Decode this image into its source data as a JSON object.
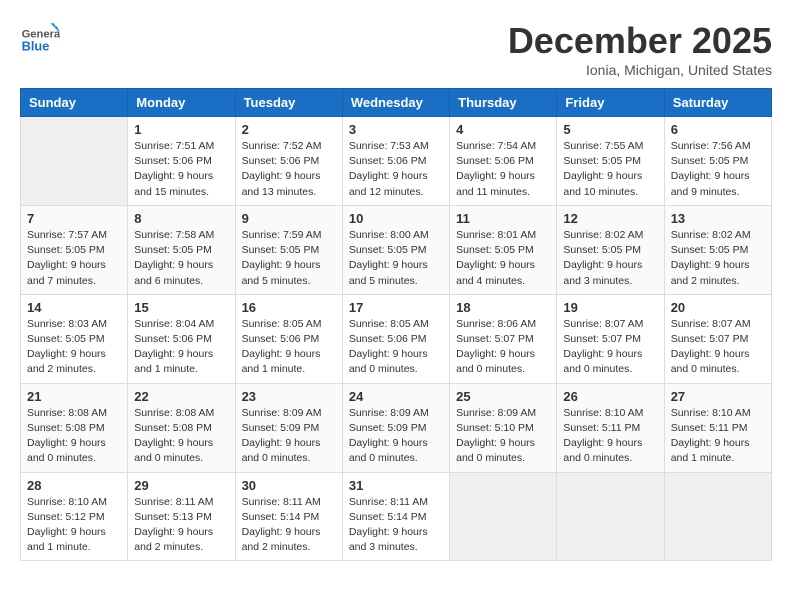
{
  "header": {
    "logo_general": "General",
    "logo_blue": "Blue",
    "month_title": "December 2025",
    "location": "Ionia, Michigan, United States"
  },
  "weekdays": [
    "Sunday",
    "Monday",
    "Tuesday",
    "Wednesday",
    "Thursday",
    "Friday",
    "Saturday"
  ],
  "weeks": [
    [
      {
        "num": "",
        "sunrise": "",
        "sunset": "",
        "daylight": ""
      },
      {
        "num": "1",
        "sunrise": "Sunrise: 7:51 AM",
        "sunset": "Sunset: 5:06 PM",
        "daylight": "Daylight: 9 hours and 15 minutes."
      },
      {
        "num": "2",
        "sunrise": "Sunrise: 7:52 AM",
        "sunset": "Sunset: 5:06 PM",
        "daylight": "Daylight: 9 hours and 13 minutes."
      },
      {
        "num": "3",
        "sunrise": "Sunrise: 7:53 AM",
        "sunset": "Sunset: 5:06 PM",
        "daylight": "Daylight: 9 hours and 12 minutes."
      },
      {
        "num": "4",
        "sunrise": "Sunrise: 7:54 AM",
        "sunset": "Sunset: 5:06 PM",
        "daylight": "Daylight: 9 hours and 11 minutes."
      },
      {
        "num": "5",
        "sunrise": "Sunrise: 7:55 AM",
        "sunset": "Sunset: 5:05 PM",
        "daylight": "Daylight: 9 hours and 10 minutes."
      },
      {
        "num": "6",
        "sunrise": "Sunrise: 7:56 AM",
        "sunset": "Sunset: 5:05 PM",
        "daylight": "Daylight: 9 hours and 9 minutes."
      }
    ],
    [
      {
        "num": "7",
        "sunrise": "Sunrise: 7:57 AM",
        "sunset": "Sunset: 5:05 PM",
        "daylight": "Daylight: 9 hours and 7 minutes."
      },
      {
        "num": "8",
        "sunrise": "Sunrise: 7:58 AM",
        "sunset": "Sunset: 5:05 PM",
        "daylight": "Daylight: 9 hours and 6 minutes."
      },
      {
        "num": "9",
        "sunrise": "Sunrise: 7:59 AM",
        "sunset": "Sunset: 5:05 PM",
        "daylight": "Daylight: 9 hours and 5 minutes."
      },
      {
        "num": "10",
        "sunrise": "Sunrise: 8:00 AM",
        "sunset": "Sunset: 5:05 PM",
        "daylight": "Daylight: 9 hours and 5 minutes."
      },
      {
        "num": "11",
        "sunrise": "Sunrise: 8:01 AM",
        "sunset": "Sunset: 5:05 PM",
        "daylight": "Daylight: 9 hours and 4 minutes."
      },
      {
        "num": "12",
        "sunrise": "Sunrise: 8:02 AM",
        "sunset": "Sunset: 5:05 PM",
        "daylight": "Daylight: 9 hours and 3 minutes."
      },
      {
        "num": "13",
        "sunrise": "Sunrise: 8:02 AM",
        "sunset": "Sunset: 5:05 PM",
        "daylight": "Daylight: 9 hours and 2 minutes."
      }
    ],
    [
      {
        "num": "14",
        "sunrise": "Sunrise: 8:03 AM",
        "sunset": "Sunset: 5:05 PM",
        "daylight": "Daylight: 9 hours and 2 minutes."
      },
      {
        "num": "15",
        "sunrise": "Sunrise: 8:04 AM",
        "sunset": "Sunset: 5:06 PM",
        "daylight": "Daylight: 9 hours and 1 minute."
      },
      {
        "num": "16",
        "sunrise": "Sunrise: 8:05 AM",
        "sunset": "Sunset: 5:06 PM",
        "daylight": "Daylight: 9 hours and 1 minute."
      },
      {
        "num": "17",
        "sunrise": "Sunrise: 8:05 AM",
        "sunset": "Sunset: 5:06 PM",
        "daylight": "Daylight: 9 hours and 0 minutes."
      },
      {
        "num": "18",
        "sunrise": "Sunrise: 8:06 AM",
        "sunset": "Sunset: 5:07 PM",
        "daylight": "Daylight: 9 hours and 0 minutes."
      },
      {
        "num": "19",
        "sunrise": "Sunrise: 8:07 AM",
        "sunset": "Sunset: 5:07 PM",
        "daylight": "Daylight: 9 hours and 0 minutes."
      },
      {
        "num": "20",
        "sunrise": "Sunrise: 8:07 AM",
        "sunset": "Sunset: 5:07 PM",
        "daylight": "Daylight: 9 hours and 0 minutes."
      }
    ],
    [
      {
        "num": "21",
        "sunrise": "Sunrise: 8:08 AM",
        "sunset": "Sunset: 5:08 PM",
        "daylight": "Daylight: 9 hours and 0 minutes."
      },
      {
        "num": "22",
        "sunrise": "Sunrise: 8:08 AM",
        "sunset": "Sunset: 5:08 PM",
        "daylight": "Daylight: 9 hours and 0 minutes."
      },
      {
        "num": "23",
        "sunrise": "Sunrise: 8:09 AM",
        "sunset": "Sunset: 5:09 PM",
        "daylight": "Daylight: 9 hours and 0 minutes."
      },
      {
        "num": "24",
        "sunrise": "Sunrise: 8:09 AM",
        "sunset": "Sunset: 5:09 PM",
        "daylight": "Daylight: 9 hours and 0 minutes."
      },
      {
        "num": "25",
        "sunrise": "Sunrise: 8:09 AM",
        "sunset": "Sunset: 5:10 PM",
        "daylight": "Daylight: 9 hours and 0 minutes."
      },
      {
        "num": "26",
        "sunrise": "Sunrise: 8:10 AM",
        "sunset": "Sunset: 5:11 PM",
        "daylight": "Daylight: 9 hours and 0 minutes."
      },
      {
        "num": "27",
        "sunrise": "Sunrise: 8:10 AM",
        "sunset": "Sunset: 5:11 PM",
        "daylight": "Daylight: 9 hours and 1 minute."
      }
    ],
    [
      {
        "num": "28",
        "sunrise": "Sunrise: 8:10 AM",
        "sunset": "Sunset: 5:12 PM",
        "daylight": "Daylight: 9 hours and 1 minute."
      },
      {
        "num": "29",
        "sunrise": "Sunrise: 8:11 AM",
        "sunset": "Sunset: 5:13 PM",
        "daylight": "Daylight: 9 hours and 2 minutes."
      },
      {
        "num": "30",
        "sunrise": "Sunrise: 8:11 AM",
        "sunset": "Sunset: 5:14 PM",
        "daylight": "Daylight: 9 hours and 2 minutes."
      },
      {
        "num": "31",
        "sunrise": "Sunrise: 8:11 AM",
        "sunset": "Sunset: 5:14 PM",
        "daylight": "Daylight: 9 hours and 3 minutes."
      },
      {
        "num": "",
        "sunrise": "",
        "sunset": "",
        "daylight": ""
      },
      {
        "num": "",
        "sunrise": "",
        "sunset": "",
        "daylight": ""
      },
      {
        "num": "",
        "sunrise": "",
        "sunset": "",
        "daylight": ""
      }
    ]
  ]
}
